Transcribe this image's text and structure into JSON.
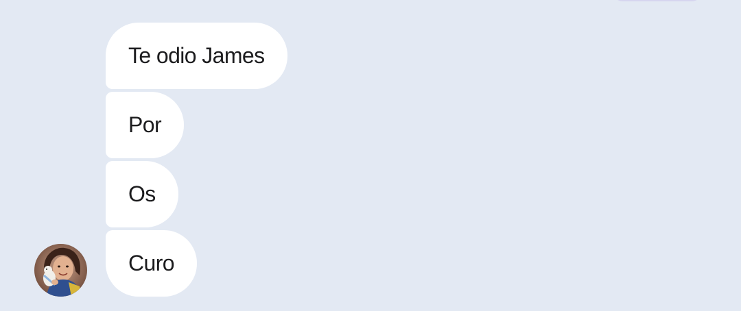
{
  "colors": {
    "background": "#e3e9f3",
    "incoming_bubble": "#ffffff",
    "incoming_text": "#1c1c1e",
    "outgoing_bubble": "#d6d5ef"
  },
  "thread": {
    "messages": [
      {
        "text": "Te odio James"
      },
      {
        "text": "Por"
      },
      {
        "text": "Os"
      },
      {
        "text": "Curo"
      }
    ]
  },
  "sender": {
    "avatar_icon": "avatar-photo"
  }
}
